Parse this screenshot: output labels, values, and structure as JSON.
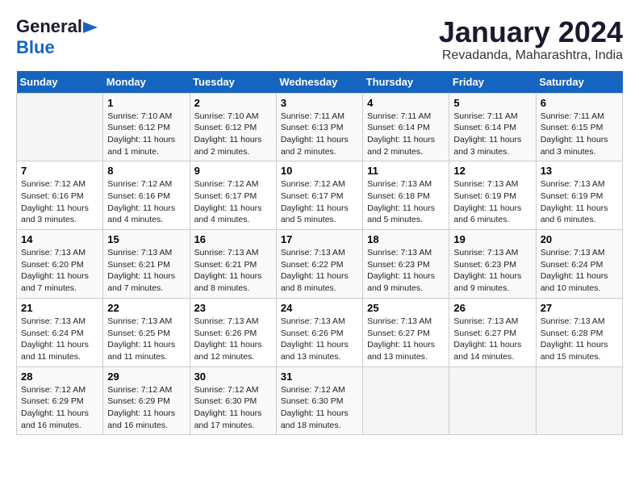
{
  "header": {
    "logo_line1": "General",
    "logo_line2": "Blue",
    "title": "January 2024",
    "subtitle": "Revadanda, Maharashtra, India"
  },
  "days_of_week": [
    "Sunday",
    "Monday",
    "Tuesday",
    "Wednesday",
    "Thursday",
    "Friday",
    "Saturday"
  ],
  "weeks": [
    [
      {
        "day": null
      },
      {
        "day": "1",
        "sunrise": "Sunrise: 7:10 AM",
        "sunset": "Sunset: 6:12 PM",
        "daylight": "Daylight: 11 hours and 1 minute."
      },
      {
        "day": "2",
        "sunrise": "Sunrise: 7:10 AM",
        "sunset": "Sunset: 6:12 PM",
        "daylight": "Daylight: 11 hours and 2 minutes."
      },
      {
        "day": "3",
        "sunrise": "Sunrise: 7:11 AM",
        "sunset": "Sunset: 6:13 PM",
        "daylight": "Daylight: 11 hours and 2 minutes."
      },
      {
        "day": "4",
        "sunrise": "Sunrise: 7:11 AM",
        "sunset": "Sunset: 6:14 PM",
        "daylight": "Daylight: 11 hours and 2 minutes."
      },
      {
        "day": "5",
        "sunrise": "Sunrise: 7:11 AM",
        "sunset": "Sunset: 6:14 PM",
        "daylight": "Daylight: 11 hours and 3 minutes."
      },
      {
        "day": "6",
        "sunrise": "Sunrise: 7:11 AM",
        "sunset": "Sunset: 6:15 PM",
        "daylight": "Daylight: 11 hours and 3 minutes."
      }
    ],
    [
      {
        "day": "7",
        "sunrise": "Sunrise: 7:12 AM",
        "sunset": "Sunset: 6:16 PM",
        "daylight": "Daylight: 11 hours and 3 minutes."
      },
      {
        "day": "8",
        "sunrise": "Sunrise: 7:12 AM",
        "sunset": "Sunset: 6:16 PM",
        "daylight": "Daylight: 11 hours and 4 minutes."
      },
      {
        "day": "9",
        "sunrise": "Sunrise: 7:12 AM",
        "sunset": "Sunset: 6:17 PM",
        "daylight": "Daylight: 11 hours and 4 minutes."
      },
      {
        "day": "10",
        "sunrise": "Sunrise: 7:12 AM",
        "sunset": "Sunset: 6:17 PM",
        "daylight": "Daylight: 11 hours and 5 minutes."
      },
      {
        "day": "11",
        "sunrise": "Sunrise: 7:13 AM",
        "sunset": "Sunset: 6:18 PM",
        "daylight": "Daylight: 11 hours and 5 minutes."
      },
      {
        "day": "12",
        "sunrise": "Sunrise: 7:13 AM",
        "sunset": "Sunset: 6:19 PM",
        "daylight": "Daylight: 11 hours and 6 minutes."
      },
      {
        "day": "13",
        "sunrise": "Sunrise: 7:13 AM",
        "sunset": "Sunset: 6:19 PM",
        "daylight": "Daylight: 11 hours and 6 minutes."
      }
    ],
    [
      {
        "day": "14",
        "sunrise": "Sunrise: 7:13 AM",
        "sunset": "Sunset: 6:20 PM",
        "daylight": "Daylight: 11 hours and 7 minutes."
      },
      {
        "day": "15",
        "sunrise": "Sunrise: 7:13 AM",
        "sunset": "Sunset: 6:21 PM",
        "daylight": "Daylight: 11 hours and 7 minutes."
      },
      {
        "day": "16",
        "sunrise": "Sunrise: 7:13 AM",
        "sunset": "Sunset: 6:21 PM",
        "daylight": "Daylight: 11 hours and 8 minutes."
      },
      {
        "day": "17",
        "sunrise": "Sunrise: 7:13 AM",
        "sunset": "Sunset: 6:22 PM",
        "daylight": "Daylight: 11 hours and 8 minutes."
      },
      {
        "day": "18",
        "sunrise": "Sunrise: 7:13 AM",
        "sunset": "Sunset: 6:23 PM",
        "daylight": "Daylight: 11 hours and 9 minutes."
      },
      {
        "day": "19",
        "sunrise": "Sunrise: 7:13 AM",
        "sunset": "Sunset: 6:23 PM",
        "daylight": "Daylight: 11 hours and 9 minutes."
      },
      {
        "day": "20",
        "sunrise": "Sunrise: 7:13 AM",
        "sunset": "Sunset: 6:24 PM",
        "daylight": "Daylight: 11 hours and 10 minutes."
      }
    ],
    [
      {
        "day": "21",
        "sunrise": "Sunrise: 7:13 AM",
        "sunset": "Sunset: 6:24 PM",
        "daylight": "Daylight: 11 hours and 11 minutes."
      },
      {
        "day": "22",
        "sunrise": "Sunrise: 7:13 AM",
        "sunset": "Sunset: 6:25 PM",
        "daylight": "Daylight: 11 hours and 11 minutes."
      },
      {
        "day": "23",
        "sunrise": "Sunrise: 7:13 AM",
        "sunset": "Sunset: 6:26 PM",
        "daylight": "Daylight: 11 hours and 12 minutes."
      },
      {
        "day": "24",
        "sunrise": "Sunrise: 7:13 AM",
        "sunset": "Sunset: 6:26 PM",
        "daylight": "Daylight: 11 hours and 13 minutes."
      },
      {
        "day": "25",
        "sunrise": "Sunrise: 7:13 AM",
        "sunset": "Sunset: 6:27 PM",
        "daylight": "Daylight: 11 hours and 13 minutes."
      },
      {
        "day": "26",
        "sunrise": "Sunrise: 7:13 AM",
        "sunset": "Sunset: 6:27 PM",
        "daylight": "Daylight: 11 hours and 14 minutes."
      },
      {
        "day": "27",
        "sunrise": "Sunrise: 7:13 AM",
        "sunset": "Sunset: 6:28 PM",
        "daylight": "Daylight: 11 hours and 15 minutes."
      }
    ],
    [
      {
        "day": "28",
        "sunrise": "Sunrise: 7:12 AM",
        "sunset": "Sunset: 6:29 PM",
        "daylight": "Daylight: 11 hours and 16 minutes."
      },
      {
        "day": "29",
        "sunrise": "Sunrise: 7:12 AM",
        "sunset": "Sunset: 6:29 PM",
        "daylight": "Daylight: 11 hours and 16 minutes."
      },
      {
        "day": "30",
        "sunrise": "Sunrise: 7:12 AM",
        "sunset": "Sunset: 6:30 PM",
        "daylight": "Daylight: 11 hours and 17 minutes."
      },
      {
        "day": "31",
        "sunrise": "Sunrise: 7:12 AM",
        "sunset": "Sunset: 6:30 PM",
        "daylight": "Daylight: 11 hours and 18 minutes."
      },
      {
        "day": null
      },
      {
        "day": null
      },
      {
        "day": null
      }
    ]
  ]
}
